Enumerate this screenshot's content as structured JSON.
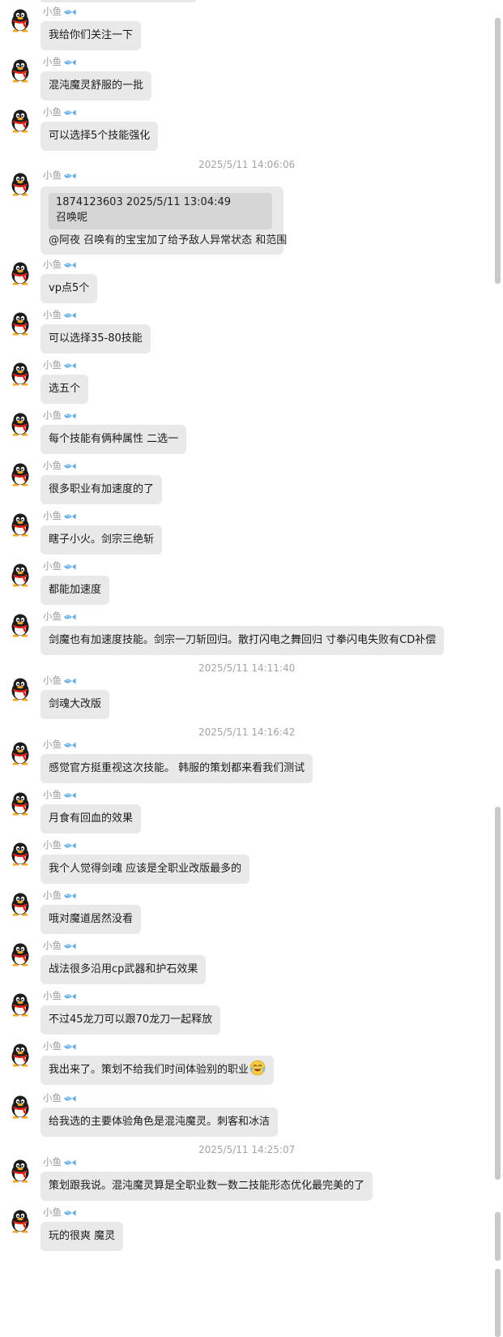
{
  "sender_name": "小鱼",
  "colors": {
    "bubble": "#e9e9e9",
    "quote": "#d6d6d6",
    "meta": "#a4a4a4"
  },
  "timestamps": [
    "2025/5/11 14:06:06",
    "2025/5/11 14:11:40",
    "2025/5/11 14:16:42",
    "2025/5/11 14:25:07"
  ],
  "messages": [
    "我给你们关注一下",
    "混沌魔灵舒服的一批",
    "可以选择5个技能强化",
    "vp点5个",
    "可以选择35-80技能",
    "选五个",
    "每个技能有俩种属性 二选一",
    "很多职业有加速度的了",
    "瞎子小火。剑宗三绝斩",
    "都能加速度",
    "剑魔也有加速度技能。剑宗一刀斩回归。散打闪电之舞回归 寸拳闪电失败有CD补偿",
    "剑魂大改版",
    "感觉官方挺重视这次技能。 韩服的策划都来看我们测试",
    "月食有回血的效果",
    " 我个人觉得剑魂 应该是全职业改版最多的",
    "哦对魔道居然没看",
    "战法很多沿用cp武器和护石效果",
    "不过45龙刀可以跟70龙刀一起释放",
    "我出来了。策划不给我们时间体验别的职业",
    "给我选的主要体验角色是混沌魔灵。刺客和冰洁",
    "策划跟我说。混沌魔灵算是全职业数一数二技能形态优化最完美的了",
    "玩的很爽 魔灵"
  ],
  "reply": {
    "quoted_header": "1874123603  2025/5/11 13:04:49",
    "quoted_text": "召唤呢",
    "text": "@阿夜 召唤有的宝宝加了给予敌人异常状态 和范围"
  },
  "icons": {
    "avatar": "qq-penguin-avatar",
    "badge": "fish-badge-icon",
    "emoji": "crying-laughing-emoji"
  }
}
